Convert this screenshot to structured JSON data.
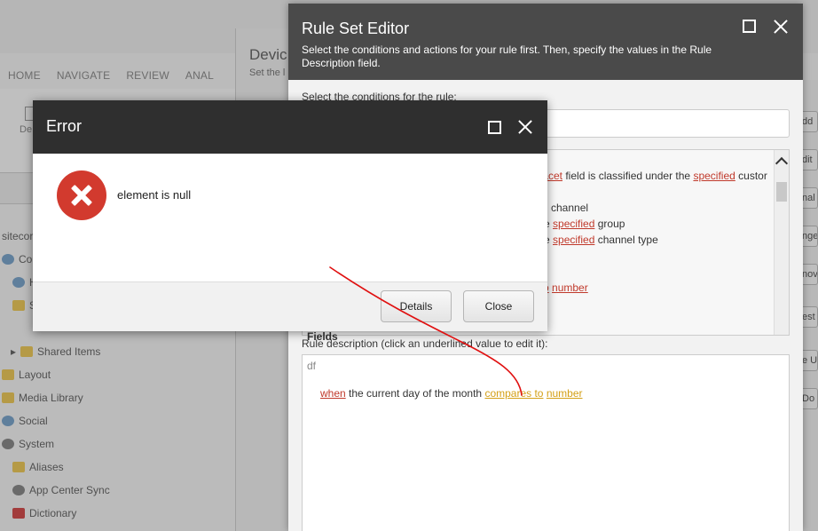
{
  "background": {
    "nav_tabs": [
      "HOME",
      "NAVIGATE",
      "REVIEW",
      "ANAL"
    ],
    "ribbon_label": "De",
    "device_title": "Devic",
    "device_sub": "Set the l",
    "tree": {
      "root": "sitecor",
      "items": [
        {
          "label": "Co",
          "icon": "folder"
        },
        {
          "label": "H",
          "icon": "globe"
        },
        {
          "label": "S",
          "icon": "folder"
        },
        {
          "label": "Shared Items",
          "icon": "folder"
        },
        {
          "label": "Layout",
          "icon": "folder"
        },
        {
          "label": "Media Library",
          "icon": "folder"
        },
        {
          "label": "Social",
          "icon": "folder"
        },
        {
          "label": "System",
          "icon": "folder"
        },
        {
          "label": "Aliases",
          "icon": "folder"
        },
        {
          "label": "App Center Sync",
          "icon": "gear"
        },
        {
          "label": "Dictionary",
          "icon": "dict"
        }
      ]
    },
    "side_buttons": [
      "dd",
      "dit",
      "nal",
      "nge",
      "nov",
      "est",
      "e U",
      "Do"
    ]
  },
  "rule_editor": {
    "title": "Rule Set Editor",
    "subtitle": "Select the conditions and actions for your rule first. Then, specify the values in the Rule Description field.",
    "conditions_label": "Select the conditions for the rule:",
    "conditions": {
      "line1_link1": "facet",
      "line1_text": " field is classified under the ",
      "line1_link2": "specified",
      "line1_text2": " custor",
      "line2_text": "channel",
      "line3_pre": "the ",
      "line3_link": "specified",
      "line3_text": " group",
      "line4_pre": "the ",
      "line4_link": "specified",
      "line4_text": " channel type",
      "line5_link1": "o",
      "line5_link2": "number"
    },
    "fields_label": "Fields",
    "description_label": "Rule description (click an underlined value to edit it):",
    "description": {
      "name": "df",
      "when": "when",
      "middle": " the current day of the month ",
      "compares": "compares to",
      "space": " ",
      "number": "number"
    }
  },
  "error_dialog": {
    "title": "Error",
    "message": "element is null",
    "details_button": "Details",
    "close_button": "Close"
  },
  "colors": {
    "dialog_header": "#2f2f2f",
    "editor_header": "#4a4a4a",
    "error_icon": "#d23a2e",
    "link_red": "#c0392b",
    "link_yellow": "#d4a017",
    "annotation": "#e01010"
  }
}
